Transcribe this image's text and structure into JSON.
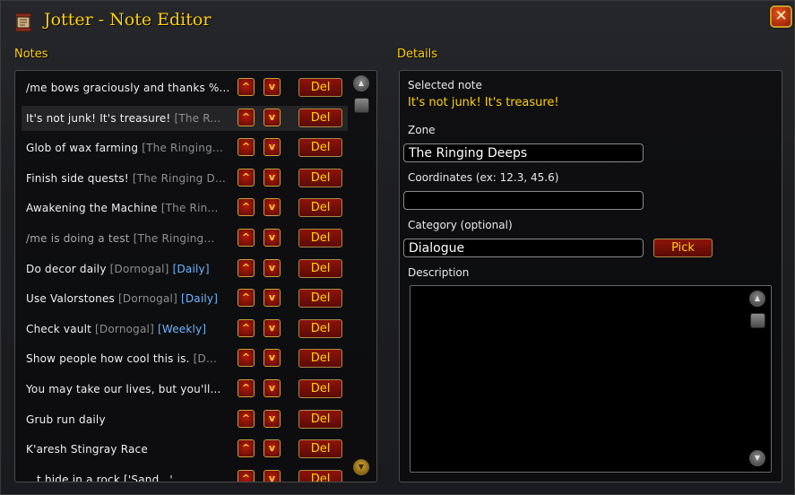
{
  "window": {
    "title": "Jotter - Note Editor",
    "close_label": "✕"
  },
  "notes": {
    "section_label": "Notes",
    "up_label": "^",
    "down_label": "v",
    "del_label": "Del",
    "items": [
      {
        "title": "/me bows graciously and thanks %...",
        "zone": "",
        "badge": "",
        "dim": false,
        "selected": false
      },
      {
        "title": "It's not junk! It's treasure!",
        "zone": "[The R...",
        "badge": "",
        "dim": false,
        "selected": true
      },
      {
        "title": "Glob of wax farming",
        "zone": "[The Ringing...",
        "badge": "",
        "dim": false,
        "selected": false
      },
      {
        "title": "Finish side quests!",
        "zone": "[The Ringing D...",
        "badge": "",
        "dim": false,
        "selected": false
      },
      {
        "title": "Awakening the Machine",
        "zone": "[The Rin...",
        "badge": "",
        "dim": false,
        "selected": false
      },
      {
        "title": "/me is doing a test",
        "zone": "[The Ringing...",
        "badge": "",
        "dim": true,
        "selected": false
      },
      {
        "title": "Do decor daily",
        "zone": "[Dornogal]",
        "badge": "[Daily]",
        "dim": false,
        "selected": false
      },
      {
        "title": "Use Valorstones",
        "zone": "[Dornogal]",
        "badge": "[Daily]",
        "dim": false,
        "selected": false
      },
      {
        "title": "Check vault",
        "zone": "[Dornogal]",
        "badge": "[Weekly]",
        "dim": false,
        "selected": false
      },
      {
        "title": "Show people how cool this is.",
        "zone": "[D...",
        "badge": "",
        "dim": false,
        "selected": false
      },
      {
        "title": "You may take our lives, but you'll...",
        "zone": "",
        "badge": "",
        "dim": false,
        "selected": false
      },
      {
        "title": "Grub run daily",
        "zone": "",
        "badge": "",
        "dim": false,
        "selected": false
      },
      {
        "title": "K'aresh Stingray Race",
        "zone": "",
        "badge": "",
        "dim": false,
        "selected": false
      },
      {
        "title": "...t hide in a rock  ['Sand...'...",
        "zone": "",
        "badge": "",
        "dim": false,
        "selected": false
      }
    ]
  },
  "details": {
    "section_label": "Details",
    "selected_label": "Selected note",
    "selected_value": "It's not junk! It's treasure!",
    "zone_label": "Zone",
    "zone_value": "The Ringing Deeps",
    "coords_label": "Coordinates (ex: 12.3, 45.6)",
    "coords_value": "",
    "category_label": "Category (optional)",
    "category_value": "Dialogue",
    "pick_label": "Pick",
    "description_label": "Description",
    "description_value": ""
  },
  "colors": {
    "gold_text": "#ffd100",
    "badge_blue": "#6db5ff",
    "zone_gray": "#8f8f8f",
    "button_red": "#8d1309"
  }
}
